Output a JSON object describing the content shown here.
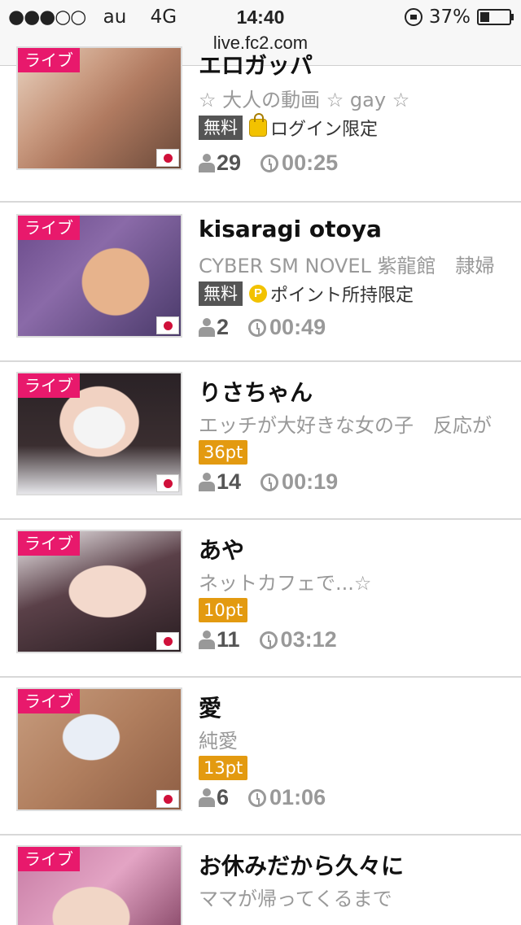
{
  "status_bar": {
    "signal_dots": "●●●○○",
    "carrier": "au",
    "network": "4G",
    "time": "14:40",
    "battery": "37%",
    "battery_level": 0.37
  },
  "address_bar": {
    "url": "live.fc2.com"
  },
  "colors": {
    "live_tag": "#e8196c",
    "points_badge": "#e39a10",
    "free_badge": "#555555"
  },
  "items": [
    {
      "tag": "ライブ",
      "name": "エロガッパ",
      "desc": "☆ 大人の動画 ☆ gay ☆",
      "badge_type": "free",
      "badge": "無料",
      "note_icon": "lock-icon",
      "note": "ログイン限定",
      "viewers": "29",
      "duration": "00:25"
    },
    {
      "tag": "ライブ",
      "name": "kisaragi otoya",
      "desc": "CYBER SM NOVEL 紫龍館　隷婦",
      "badge_type": "free",
      "badge": "無料",
      "note_icon": "point-icon",
      "note": "ポイント所持限定",
      "viewers": "2",
      "duration": "00:49"
    },
    {
      "tag": "ライブ",
      "name": "りさちゃん",
      "desc": "エッチが大好きな女の子　反応が",
      "badge_type": "points",
      "badge": "36pt",
      "note": "",
      "viewers": "14",
      "duration": "00:19"
    },
    {
      "tag": "ライブ",
      "name": "あや",
      "desc": "ネットカフェで...☆",
      "badge_type": "points",
      "badge": "10pt",
      "note": "",
      "viewers": "11",
      "duration": "03:12"
    },
    {
      "tag": "ライブ",
      "name": "愛",
      "desc": "純愛",
      "badge_type": "points",
      "badge": "13pt",
      "note": "",
      "viewers": "6",
      "duration": "01:06"
    },
    {
      "tag": "ライブ",
      "name": "お休みだから久々に",
      "desc": "ママが帰ってくるまで",
      "badge_type": "points",
      "badge": "",
      "note": "",
      "viewers": "",
      "duration": ""
    }
  ]
}
